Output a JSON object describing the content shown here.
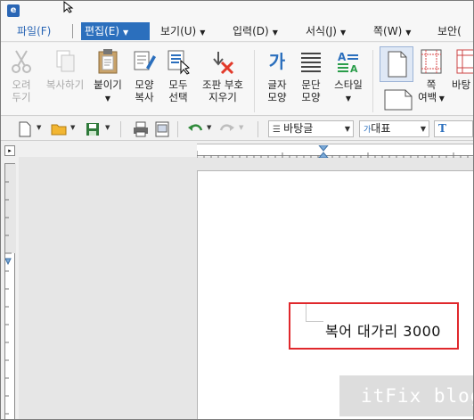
{
  "app": {
    "icon_glyph": "e"
  },
  "menubar": {
    "file": "파일(F)",
    "items": [
      {
        "label": "편집(E)",
        "active": true
      },
      {
        "label": "보기(U)"
      },
      {
        "label": "입력(D)"
      },
      {
        "label": "서식(J)"
      },
      {
        "label": "쪽(W)"
      },
      {
        "label": "보안("
      }
    ]
  },
  "ribbon": {
    "cut": {
      "line1": "오려",
      "line2": "두기"
    },
    "copy": {
      "line1": "복사하기"
    },
    "paste": {
      "line1": "붙이기"
    },
    "shape_copy": {
      "line1": "모양",
      "line2": "복사"
    },
    "select_all": {
      "line1": "모두",
      "line2": "선택"
    },
    "erase_marks": {
      "line1": "조판 부호",
      "line2": "지우기"
    },
    "char_shape": {
      "line1": "글자",
      "line2": "모양",
      "icon_text": "가"
    },
    "para_shape": {
      "line1": "문단",
      "line2": "모양"
    },
    "style": {
      "line1": "스타일"
    },
    "page_margin": {
      "line1": "쪽",
      "line2": "여백"
    },
    "background": {
      "line1": "바탕"
    }
  },
  "toolbar": {
    "style_select": "바탕글",
    "font_select": "대표",
    "font_select_prefix": "가"
  },
  "document": {
    "text": "복어 대가리 3000"
  },
  "watermark": "itFix blog",
  "colors": {
    "accent": "#2b6fbd",
    "highlight": "#e0282c"
  }
}
